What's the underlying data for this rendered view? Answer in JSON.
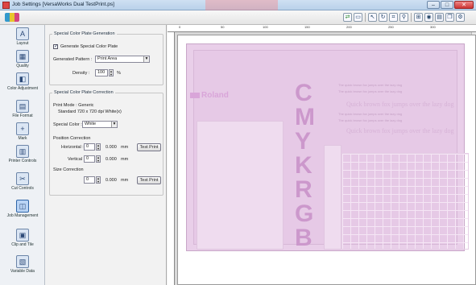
{
  "window": {
    "title": "Job Settings [VersaWorks Dual TestPrint.ps]",
    "minimize_glyph": "–",
    "maximize_glyph": "□",
    "close_glyph": "✕"
  },
  "toolbar": {
    "logo": "versaworks-logo",
    "icons": [
      "green-arrows-icon",
      "print-preview-icon",
      "pointer-icon",
      "rotate-icon",
      "crop-icon",
      "zoom-icon",
      "fit-icon",
      "view-icon",
      "layout-icon",
      "copy-icon",
      "settings-icon"
    ]
  },
  "sidebar": {
    "items": [
      {
        "label": "Layout",
        "icon": "layout-icon",
        "glyph": "A"
      },
      {
        "label": "Quality",
        "icon": "quality-icon",
        "glyph": "▦"
      },
      {
        "label": "Color Adjustment",
        "icon": "color-adjust-icon",
        "glyph": "◧"
      },
      {
        "label": "File Format",
        "icon": "file-format-icon",
        "glyph": "▤"
      },
      {
        "label": "Mark",
        "icon": "mark-icon",
        "glyph": "+"
      },
      {
        "label": "Printer Controls",
        "icon": "printer-icon",
        "glyph": "▥"
      },
      {
        "label": "Cut Controls",
        "icon": "cut-icon",
        "glyph": "✂"
      },
      {
        "label": "Job Management",
        "icon": "job-management-icon",
        "glyph": "◫"
      },
      {
        "label": "Clip and Tile",
        "icon": "clip-tile-icon",
        "glyph": "▣"
      },
      {
        "label": "Variable Data",
        "icon": "variable-data-icon",
        "glyph": "▧"
      }
    ]
  },
  "generation": {
    "title": "Special Color Plate Generation",
    "generate_checkbox_label": "Generate Special Color Plate",
    "generate_checked": true,
    "pattern_label": "Generated Pattern :",
    "pattern_value": "Print Area",
    "density_label": "Density :",
    "density_value": "100",
    "density_unit": "%"
  },
  "correction": {
    "title": "Special Color Plate Correction",
    "print_mode_label": "Print Mode : Generic",
    "print_mode_value": "Standard 720 x 720 dpi White(x)",
    "special_color_label": "Special Color :",
    "special_color_value": "White",
    "position_label": "Position Correction",
    "horizontal_label": "Horizontal :",
    "horizontal_value": "0",
    "horizontal_mm": "0.000",
    "vertical_label": "Vertical :",
    "vertical_value": "0",
    "vertical_mm": "0.000",
    "unit": "mm",
    "size_label": "Size Correction",
    "size_value": "0",
    "size_mm": "0.000",
    "test_print_label": "Test Print"
  },
  "preview": {
    "ruler_ticks": [
      "0",
      "50",
      "100",
      "150",
      "200",
      "250",
      "300"
    ],
    "roland_text": "Roland",
    "letters": [
      "C",
      "M",
      "Y",
      "K",
      "R",
      "G",
      "B"
    ],
    "script_lines": [
      "Quick brown fox jumps over the lazy dog",
      "Quick brown fox jumps over the lazy dog"
    ],
    "small_lines": [
      "The quick brown fox jumps over the lazy dog",
      "The quick brown fox jumps over the lazy dog",
      "The quick brown fox jumps over the lazy dog",
      "The quick brown fox jumps over the lazy dog"
    ]
  },
  "colors": {
    "plate": "#e9cfe9",
    "accent": "#cc98cc"
  }
}
